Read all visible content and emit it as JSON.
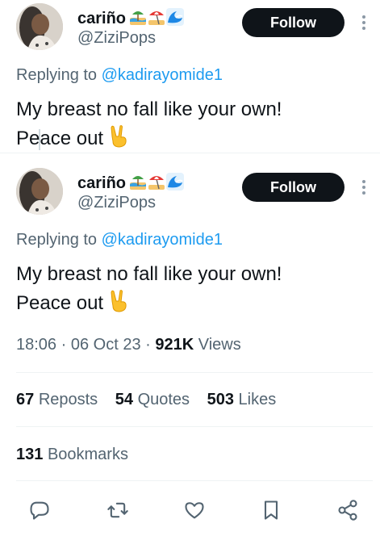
{
  "tweets": [
    {
      "display_name": "cariño",
      "name_emojis": [
        "beach-with-umbrella-icon",
        "beach-umbrella-icon",
        "water-wave-icon"
      ],
      "handle": "@ZiziPops",
      "follow_label": "Follow",
      "replying_prefix": "Replying to",
      "replying_to": "@kadirayomide1",
      "text_line1": "My breast no fall like your own!",
      "text_line2": "Peace out",
      "text_emoji": "victory-hand-icon"
    },
    {
      "display_name": "cariño",
      "name_emojis": [
        "beach-with-umbrella-icon",
        "beach-umbrella-icon",
        "water-wave-icon"
      ],
      "handle": "@ZiziPops",
      "follow_label": "Follow",
      "replying_prefix": "Replying to",
      "replying_to": "@kadirayomide1",
      "text_line1": "My breast no fall like your own!",
      "text_line2": "Peace out",
      "text_emoji": "victory-hand-icon"
    }
  ],
  "meta": {
    "time": "18:06",
    "sep1": "·",
    "date": "06 Oct 23",
    "sep2": "·",
    "views_count": "921K",
    "views_label": "Views"
  },
  "stats": {
    "reposts_count": "67",
    "reposts_label": "Reposts",
    "quotes_count": "54",
    "quotes_label": "Quotes",
    "likes_count": "503",
    "likes_label": "Likes",
    "bookmarks_count": "131",
    "bookmarks_label": "Bookmarks"
  },
  "actions": [
    "reply-icon",
    "retweet-icon",
    "like-icon",
    "bookmark-icon",
    "share-icon"
  ],
  "colors": {
    "text": "#0f1419",
    "secondary": "#536471",
    "link": "#1d9bf0",
    "button_bg": "#0f1419",
    "divider": "#eff3f4"
  }
}
